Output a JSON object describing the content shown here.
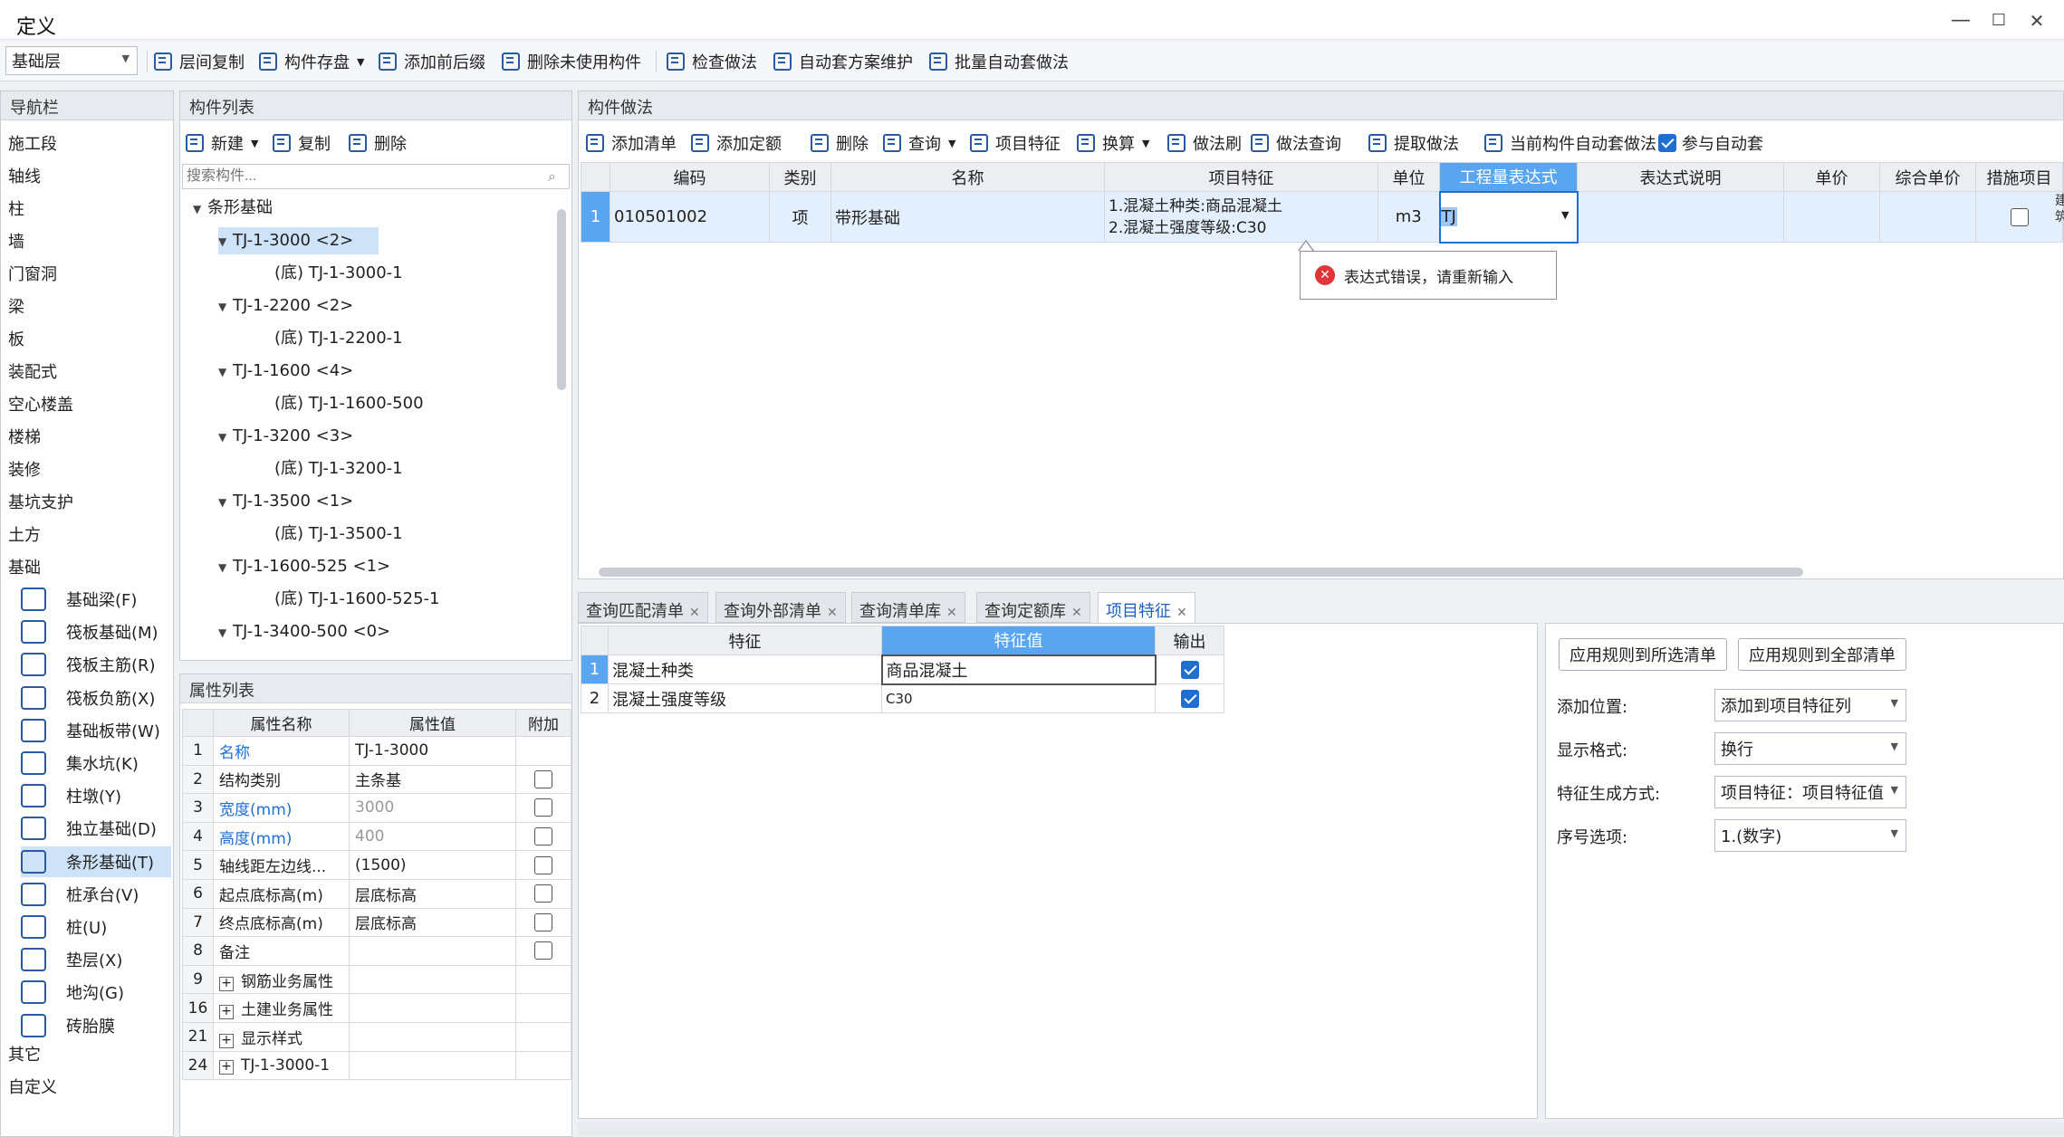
{
  "window": {
    "title": "定义",
    "min": "—",
    "max": "☐",
    "close": "✕"
  },
  "toolbar": {
    "floor": "基础层",
    "items": [
      "层间复制",
      "构件存盘",
      "添加前后缀",
      "删除未使用构件",
      "检查做法",
      "自动套方案维护",
      "批量自动套做法"
    ]
  },
  "nav": {
    "title": "导航栏",
    "items": [
      "施工段",
      "轴线",
      "柱",
      "墙",
      "门窗洞",
      "梁",
      "板",
      "装配式",
      "空心楼盖",
      "楼梯",
      "装修",
      "基坑支护",
      "土方",
      "基础"
    ],
    "sub": [
      "基础梁(F)",
      "筏板基础(M)",
      "筏板主筋(R)",
      "筏板负筋(X)",
      "基础板带(W)",
      "集水坑(K)",
      "柱墩(Y)",
      "独立基础(D)",
      "条形基础(T)",
      "桩承台(V)",
      "桩(U)",
      "垫层(X)",
      "地沟(G)",
      "砖胎膜"
    ],
    "tail": [
      "其它",
      "自定义"
    ]
  },
  "complist": {
    "title": "构件列表",
    "new": "新建",
    "copy": "复制",
    "delete": "删除",
    "search_placeholder": "搜索构件...",
    "tree": [
      "条形基础",
      "TJ-1-3000 <2>",
      "(底) TJ-1-3000-1",
      "TJ-1-2200 <2>",
      "(底) TJ-1-2200-1",
      "TJ-1-1600 <4>",
      "(底) TJ-1-1600-500",
      "TJ-1-3200 <3>",
      "(底) TJ-1-3200-1",
      "TJ-1-3500 <1>",
      "(底) TJ-1-3500-1",
      "TJ-1-1600-525 <1>",
      "(底) TJ-1-1600-525-1",
      "TJ-1-3400-500 <0>"
    ]
  },
  "props": {
    "title": "属性列表",
    "headers": [
      "属性名称",
      "属性值",
      "附加"
    ],
    "rows": [
      [
        "1",
        "名称",
        "TJ-1-3000"
      ],
      [
        "2",
        "结构类别",
        "主条基"
      ],
      [
        "3",
        "宽度(mm)",
        "3000"
      ],
      [
        "4",
        "高度(mm)",
        "400"
      ],
      [
        "5",
        "轴线距左边线...",
        "(1500)"
      ],
      [
        "6",
        "起点底标高(m)",
        "层底标高"
      ],
      [
        "7",
        "终点底标高(m)",
        "层底标高"
      ],
      [
        "8",
        "备注",
        ""
      ],
      [
        "9",
        "钢筋业务属性",
        ""
      ],
      [
        "16",
        "土建业务属性",
        ""
      ],
      [
        "21",
        "显示样式",
        ""
      ],
      [
        "24",
        "TJ-1-3000-1",
        ""
      ]
    ]
  },
  "method": {
    "title": "构件做法",
    "toolbar": [
      "添加清单",
      "添加定额",
      "删除",
      "查询",
      "项目特征",
      "换算",
      "做法刷",
      "做法查询",
      "提取做法",
      "当前构件自动套做法",
      "参与自动套"
    ],
    "headers": [
      "编码",
      "类别",
      "名称",
      "项目特征",
      "单位",
      "工程量表达式",
      "表达式说明",
      "单价",
      "综合单价",
      "措施项目"
    ],
    "row": {
      "no": "1",
      "code": "010501002",
      "type": "项",
      "name": "带形基础",
      "feature1": "1.混凝土种类:商品混凝土",
      "feature2": "2.混凝土强度等级:C30",
      "unit": "m3",
      "expr": "TJ",
      "edge": "建筑"
    },
    "error": "表达式错误，请重新输入"
  },
  "tabs": [
    "查询匹配清单",
    "查询外部清单",
    "查询清单库",
    "查询定额库",
    "项目特征"
  ],
  "features": {
    "headers": [
      "特征",
      "特征值",
      "输出"
    ],
    "rows": [
      [
        "1",
        "混凝土种类",
        "商品混凝土"
      ],
      [
        "2",
        "混凝土强度等级",
        "C30"
      ]
    ]
  },
  "rules": {
    "btn1": "应用规则到所选清单",
    "btn2": "应用规则到全部清单",
    "fields": [
      {
        "label": "添加位置:",
        "value": "添加到项目特征列"
      },
      {
        "label": "显示格式:",
        "value": "换行"
      },
      {
        "label": "特征生成方式:",
        "value": "项目特征：项目特征值"
      },
      {
        "label": "序号选项:",
        "value": "1.(数字)"
      }
    ]
  },
  "colors": {
    "accent": "#1f6fd1",
    "header_active": "#5aa5f0",
    "selected": "#cfe3f8",
    "error": "#e0353a"
  }
}
